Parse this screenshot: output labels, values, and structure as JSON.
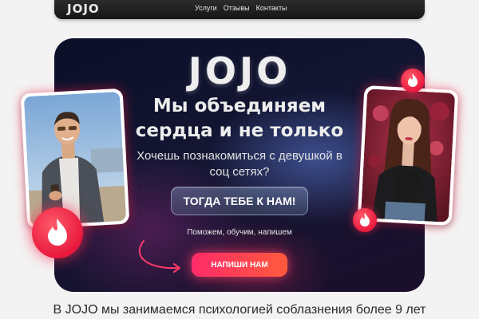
{
  "nav": {
    "logo": "JOJO",
    "links": [
      "Услуги",
      "Отзывы",
      "Контакты"
    ]
  },
  "hero": {
    "brand": "JOJO",
    "headline_line1": "Мы объединяем",
    "headline_line2": "сердца и не только",
    "subtitle": "Хочешь познакомиться с девушкой в соц сетях?",
    "secondary_cta": "ТОГДА ТЕБЕ К НАМ!",
    "tagline": "Поможем, обучим, напишем",
    "primary_cta": "НАПИШИ НАМ"
  },
  "bottom": {
    "text": "В JOJO мы занимаемся психологией соблазнения более 9 лет"
  },
  "colors": {
    "accent": "#ff2b6a",
    "hero_bg": "#0b0f27",
    "nav_bg": "#1e1e1e"
  },
  "icons": [
    "flame-icon",
    "arrow-icon"
  ]
}
